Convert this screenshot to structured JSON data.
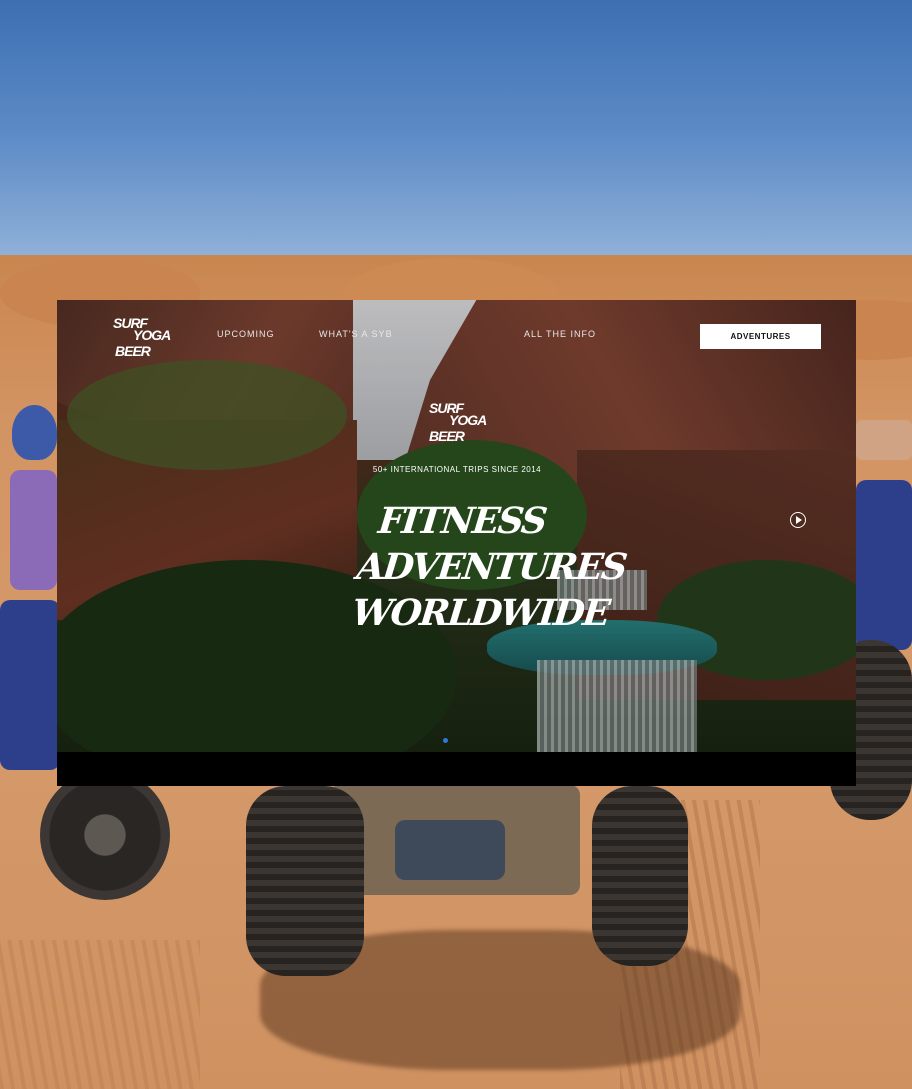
{
  "site": {
    "logo": {
      "line1": "SURF",
      "line2": "YOGA",
      "line3": "BEER"
    },
    "nav": {
      "links": [
        "UPCOMING",
        "WHAT'S A SYB",
        "",
        "ALL THE INFO"
      ],
      "cta_label": "ADVENTURES"
    },
    "hero": {
      "tagline": "50+ INTERNATIONAL TRIPS SINCE 2014",
      "headline": [
        "FITNESS",
        "ADVENTURES",
        "WORLDWIDE"
      ],
      "play_icon": "play-circle-icon"
    }
  },
  "colors": {
    "cta_background": "#ffffff",
    "slider_dot": "#2b7bd9",
    "sky": "#4a7bbf",
    "sand": "#d39463"
  }
}
